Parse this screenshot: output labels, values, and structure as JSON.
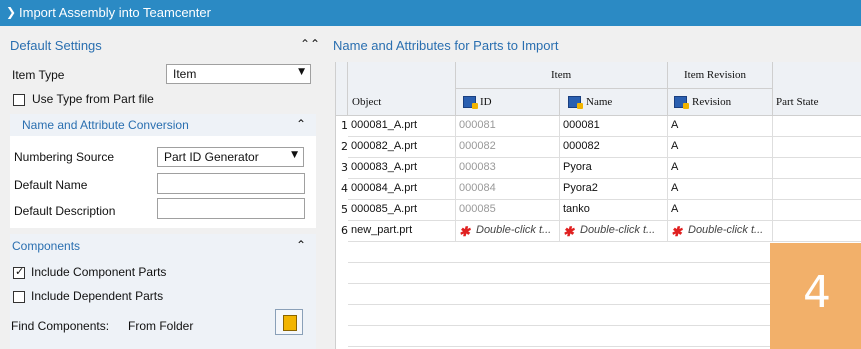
{
  "window": {
    "title": "Import Assembly into Teamcenter"
  },
  "default_settings": {
    "label": "Default Settings",
    "item_type_label": "Item Type",
    "item_type_value": "Item",
    "use_type_label": "Use Type from Part file"
  },
  "naming": {
    "label": "Name and Attribute Conversion",
    "numbering_source_label": "Numbering Source",
    "numbering_source_value": "Part ID Generator",
    "default_name_label": "Default Name",
    "default_description_label": "Default Description"
  },
  "components": {
    "label": "Components",
    "include_component_label": "Include Component Parts",
    "include_dependent_label": "Include Dependent Parts",
    "find_label": "Find Components:",
    "find_value": "From Folder"
  },
  "parts_table": {
    "section_label": "Name and Attributes for Parts to Import",
    "group_item": "Item",
    "group_revision": "Item Revision",
    "col_object": "Object",
    "col_id": "ID",
    "col_name": "Name",
    "col_revision": "Revision",
    "col_state": "Part State",
    "rows": [
      {
        "n": "1",
        "object": "000081_A.prt",
        "id": "000081",
        "name": "000081",
        "rev": "A"
      },
      {
        "n": "2",
        "object": "000082_A.prt",
        "id": "000082",
        "name": "000082",
        "rev": "A"
      },
      {
        "n": "3",
        "object": "000083_A.prt",
        "id": "000083",
        "name": "Pyora",
        "rev": "A"
      },
      {
        "n": "4",
        "object": "000084_A.prt",
        "id": "000084",
        "name": "Pyora2",
        "rev": "A"
      },
      {
        "n": "5",
        "object": "000085_A.prt",
        "id": "000085",
        "name": "tanko",
        "rev": "A"
      },
      {
        "n": "6",
        "object": "new_part.prt",
        "id": "Double-click t...",
        "name": "Double-click t...",
        "rev": "Double-click t..."
      }
    ]
  },
  "badge": "4",
  "colors": {
    "titlebar": "#2b8ac4",
    "accent_text": "#2a6fb0",
    "badge": "#f2b06a"
  }
}
